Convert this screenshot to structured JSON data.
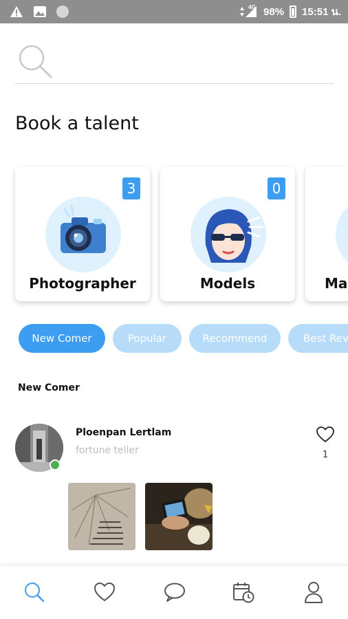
{
  "status_bar": {
    "network": "4G",
    "battery": "98%",
    "time": "15:51 น."
  },
  "search": {
    "placeholder": ""
  },
  "section_title": "Book a talent",
  "categories": [
    {
      "label": "Photographer",
      "count": "3"
    },
    {
      "label": "Models",
      "count": "0"
    },
    {
      "label": "Mal"
    }
  ],
  "filters": [
    {
      "label": "New Comer",
      "active": true
    },
    {
      "label": "Popular",
      "active": false
    },
    {
      "label": "Recommend",
      "active": false
    },
    {
      "label": "Best Rev",
      "active": false
    }
  ],
  "list_title": "New Comer",
  "talent": {
    "name": "Ploenpan Lertlam",
    "role": "fortune teller",
    "likes": "1"
  },
  "nav": [
    "search",
    "favorites",
    "messages",
    "bookings",
    "profile"
  ],
  "colors": {
    "accent": "#3d9df1",
    "chip_inactive": "#b7dcfa",
    "status_bar": "#8e8e8e",
    "online": "#4caf50"
  }
}
